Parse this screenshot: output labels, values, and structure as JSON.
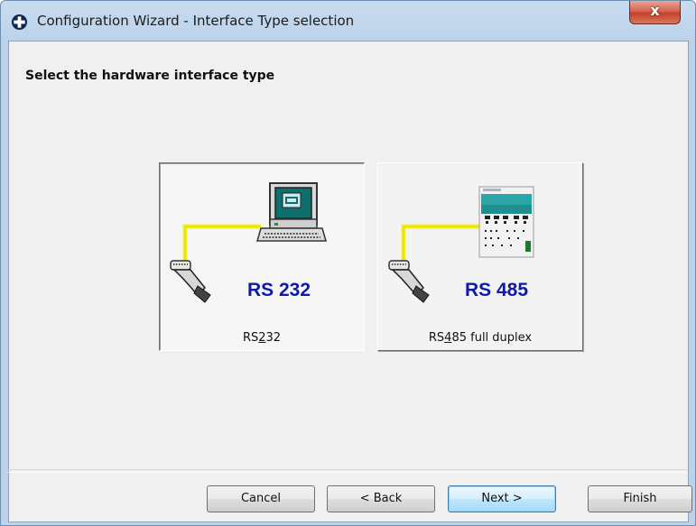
{
  "window": {
    "title": "Configuration Wizard - Interface Type selection",
    "close_glyph": "x",
    "app_icon": "cross-circle-icon"
  },
  "heading": "Select the hardware interface type",
  "options": [
    {
      "art_label": "RS 232",
      "label_pre": "RS",
      "label_mnemonic": "2",
      "label_post": "32",
      "icon": "computer-with-cable-icon",
      "selected": true
    },
    {
      "art_label": "RS 485",
      "label_pre": "RS",
      "label_mnemonic": "4",
      "label_post": "85 full duplex",
      "icon": "device-module-with-cable-icon",
      "selected": false
    }
  ],
  "buttons": {
    "cancel": "Cancel",
    "back": "< Back",
    "next": "Next >",
    "finish": "Finish"
  },
  "colors": {
    "cable": "#f5f21e",
    "art_text": "#0e1aa8",
    "accent": "#3c7fb1"
  }
}
